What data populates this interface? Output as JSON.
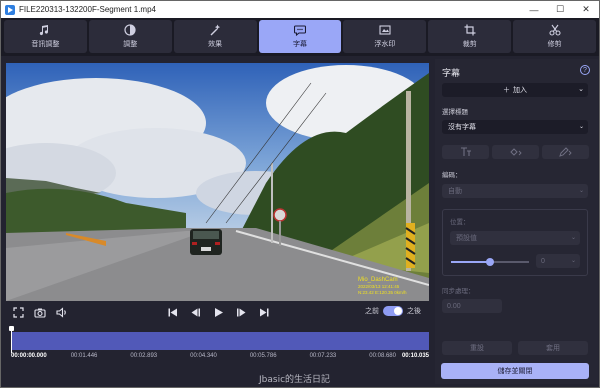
{
  "window": {
    "title": "FILE220313-132200F-Segment 1.mp4",
    "minimize": "—",
    "maximize": "☐",
    "close": "✕"
  },
  "toolbar": {
    "tabs": [
      {
        "label": "音訊調整",
        "icon": "music-note-icon",
        "active": false
      },
      {
        "label": "調整",
        "icon": "adjust-icon",
        "active": false
      },
      {
        "label": "效果",
        "icon": "effects-wand-icon",
        "active": false
      },
      {
        "label": "字幕",
        "icon": "subtitle-bubble-icon",
        "active": true
      },
      {
        "label": "浮水印",
        "icon": "watermark-icon",
        "active": false
      },
      {
        "label": "裁剪",
        "icon": "crop-icon",
        "active": false
      },
      {
        "label": "修剪",
        "icon": "scissors-icon",
        "active": false
      }
    ]
  },
  "player": {
    "overlay_label": "Mio_DashCam",
    "overlay_stamp_1": "2022/03/13 12:41:45",
    "overlay_stamp_2": "N:23.42 E:120.35 0km/h",
    "before_label": "之前",
    "after_label": "之後",
    "compare_enabled": true
  },
  "timeline": {
    "progress": 0.0,
    "ticks": [
      "00:00:00.000",
      "00:01.446",
      "00:02.893",
      "00:04.340",
      "00:05.786",
      "00:07.233",
      "00:08.680",
      "00:10.035"
    ]
  },
  "panel": {
    "title": "字幕",
    "help": "?",
    "add_label": "加入",
    "track_label": "選擇標題",
    "track_value": "沒有字幕",
    "encoding_label": "編碼：",
    "encoding_value": "自動",
    "position_label": "位置：",
    "position_value": "預設值",
    "position_number": "0",
    "slider_level": 0.5,
    "sync_label": "同步處理：",
    "sync_value": "0.00",
    "reset_label": "重設",
    "apply_label": "套用"
  },
  "footer": {
    "save_label": "儲存並關閉",
    "watermark": "Jbasic的生活日記"
  },
  "colors": {
    "accent": "#9aa7f7",
    "track": "#5159b8",
    "background": "#232330"
  }
}
